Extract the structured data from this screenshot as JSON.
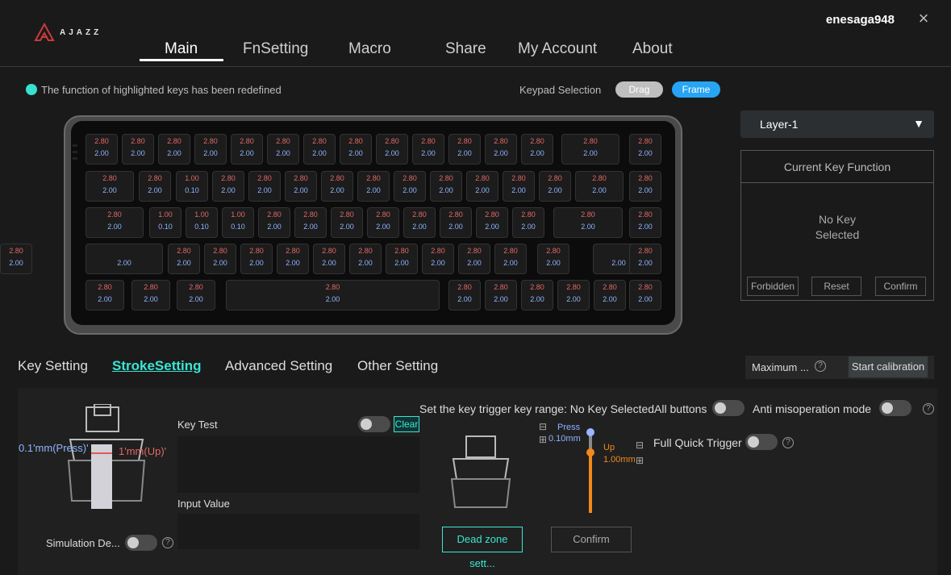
{
  "app": {
    "brand": "AJAZZ",
    "username": "enesaga948",
    "close_icon": "×"
  },
  "nav": {
    "tabs": [
      "Main",
      "FnSetting",
      "Macro",
      "Share",
      "My Account",
      "About"
    ],
    "active": "Main"
  },
  "status": {
    "text": "The function of highlighted keys has been redefined",
    "accent": "#37e0cf"
  },
  "keypad": {
    "label": "Keypad Selection",
    "drag": "Drag",
    "frame": "Frame"
  },
  "keyboard": {
    "rows": [
      [
        {
          "t": "2.80",
          "b": "2.00"
        },
        {
          "t": "2.80",
          "b": "2.00"
        },
        {
          "t": "2.80",
          "b": "2.00"
        },
        {
          "t": "2.80",
          "b": "2.00"
        },
        {
          "t": "2.80",
          "b": "2.00"
        },
        {
          "t": "2.80",
          "b": "2.00"
        },
        {
          "t": "2.80",
          "b": "2.00"
        },
        {
          "t": "2.80",
          "b": "2.00"
        },
        {
          "t": "2.80",
          "b": "2.00"
        },
        {
          "t": "2.80",
          "b": "2.00"
        },
        {
          "t": "2.80",
          "b": "2.00"
        },
        {
          "t": "2.80",
          "b": "2.00"
        },
        {
          "t": "2.80",
          "b": "2.00"
        },
        {
          "t": "2.80",
          "b": "2.00"
        },
        {
          "t": "2.80",
          "b": "2.00"
        }
      ],
      [
        {
          "t": "2.80",
          "b": "2.00"
        },
        {
          "t": "2.80",
          "b": "2.00"
        },
        {
          "t": "1.00",
          "b": "0.10"
        },
        {
          "t": "2.80",
          "b": "2.00"
        },
        {
          "t": "2.80",
          "b": "2.00"
        },
        {
          "t": "2.80",
          "b": "2.00"
        },
        {
          "t": "2.80",
          "b": "2.00"
        },
        {
          "t": "2.80",
          "b": "2.00"
        },
        {
          "t": "2.80",
          "b": "2.00"
        },
        {
          "t": "2.80",
          "b": "2.00"
        },
        {
          "t": "2.80",
          "b": "2.00"
        },
        {
          "t": "2.80",
          "b": "2.00"
        },
        {
          "t": "2.80",
          "b": "2.00"
        },
        {
          "t": "2.80",
          "b": "2.00"
        },
        {
          "t": "2.80",
          "b": "2.00"
        }
      ],
      [
        {
          "t": "2.80",
          "b": "2.00"
        },
        {
          "t": "1.00",
          "b": "0.10"
        },
        {
          "t": "1.00",
          "b": "0.10"
        },
        {
          "t": "1.00",
          "b": "0.10"
        },
        {
          "t": "2.80",
          "b": "2.00"
        },
        {
          "t": "2.80",
          "b": "2.00"
        },
        {
          "t": "2.80",
          "b": "2.00"
        },
        {
          "t": "2.80",
          "b": "2.00"
        },
        {
          "t": "2.80",
          "b": "2.00"
        },
        {
          "t": "2.80",
          "b": "2.00"
        },
        {
          "t": "2.80",
          "b": "2.00"
        },
        {
          "t": "2.80",
          "b": "2.00"
        },
        {
          "t": "2.80",
          "b": "2.00"
        },
        {
          "t": "2.80",
          "b": "2.00"
        }
      ],
      [
        {
          "t": "",
          "b": "2.00"
        },
        {
          "t": "2.80",
          "b": "2.00"
        },
        {
          "t": "2.80",
          "b": "2.00"
        },
        {
          "t": "2.80",
          "b": "2.00"
        },
        {
          "t": "2.80",
          "b": "2.00"
        },
        {
          "t": "2.80",
          "b": "2.00"
        },
        {
          "t": "2.80",
          "b": "2.00"
        },
        {
          "t": "2.80",
          "b": "2.00"
        },
        {
          "t": "2.80",
          "b": "2.00"
        },
        {
          "t": "2.80",
          "b": "2.00"
        },
        {
          "t": "2.80",
          "b": "2.00"
        },
        {
          "t": "2.80",
          "b": "2.00"
        },
        {
          "t": "",
          "b": "2.00"
        },
        {
          "t": "2.80",
          "b": "2.00"
        },
        {
          "t": "2.80",
          "b": "2.00"
        }
      ],
      [
        {
          "t": "2.80",
          "b": "2.00"
        },
        {
          "t": "2.80",
          "b": "2.00"
        },
        {
          "t": "2.80",
          "b": "2.00"
        },
        {
          "t": "2.80",
          "b": "2.00"
        },
        {
          "t": "2.80",
          "b": "2.00"
        },
        {
          "t": "2.80",
          "b": "2.00"
        },
        {
          "t": "2.80",
          "b": "2.00"
        },
        {
          "t": "2.80",
          "b": "2.00"
        },
        {
          "t": "2.80",
          "b": "2.00"
        },
        {
          "t": "2.80",
          "b": "2.00"
        }
      ]
    ]
  },
  "layer": {
    "label": "Layer-1",
    "arrow_icon": "▼"
  },
  "current_key": {
    "title": "Current Key Function",
    "empty_line1": "No Key",
    "empty_line2": "Selected",
    "forbidden": "Forbidden",
    "reset": "Reset",
    "confirm": "Confirm"
  },
  "subtabs": {
    "items": [
      "Key Setting",
      "StrokeSetting",
      "Advanced Setting",
      "Other Setting"
    ],
    "active": "StrokeSetting"
  },
  "calibration": {
    "max_label": "Maximum ...",
    "help_icon": "?",
    "start": "Start calibration"
  },
  "stroke": {
    "press_label": "0.1'mm(Press)'",
    "up_label": "1'mm(Up)'",
    "key_test": "Key Test",
    "clear": "Clear",
    "input_value": "Input Value",
    "simulation": "Simulation De...",
    "trigger_range": "Set the key trigger key range: No Key SelectedAll buttons",
    "anti_misop": "Anti misoperation mode",
    "full_quick": "Full Quick Trigger",
    "press_small": "Press",
    "press_value": "0.10mm",
    "up_small": "Up",
    "up_value": "1.00mm",
    "dead_zone": "Dead zone sett...",
    "confirm": "Confirm",
    "slider_press_fraction": 0.0,
    "slider_up_fraction": 0.25
  }
}
